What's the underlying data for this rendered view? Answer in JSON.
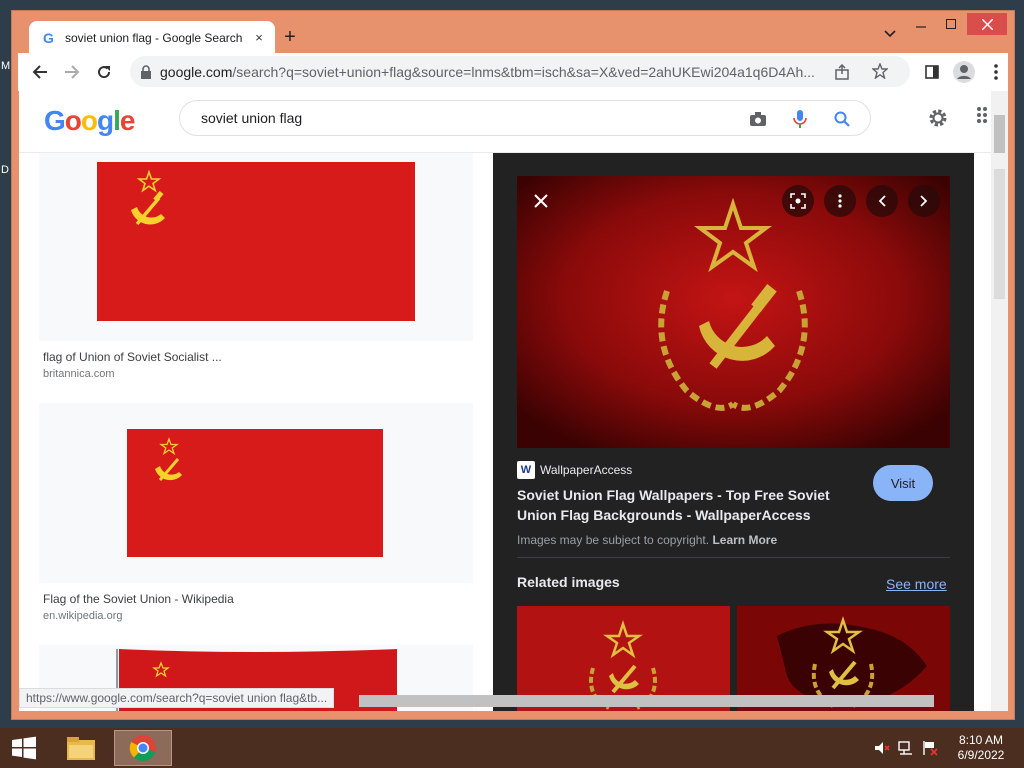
{
  "desktop": {
    "edge_text_1": "M",
    "edge_text_2": "D"
  },
  "tab": {
    "title": "soviet union flag - Google Search",
    "close": "×",
    "new_tab": "+"
  },
  "address_bar": {
    "host": "google.com",
    "path": "/search?q=soviet+union+flag&source=lnms&tbm=isch&sa=X&ved=2ahUKEwi204a1q6D4Ah..."
  },
  "search": {
    "query": "soviet union flag"
  },
  "results": [
    {
      "caption": "flag of Union of Soviet Socialist ...",
      "source": "britannica.com"
    },
    {
      "caption": "Flag of the Soviet Union - Wikipedia",
      "source": "en.wikipedia.org"
    }
  ],
  "preview": {
    "site_name": "WallpaperAccess",
    "site_logo": "W",
    "title": "Soviet Union Flag Wallpapers - Top Free Soviet Union Flag Backgrounds - WallpaperAccess",
    "visit_label": "Visit",
    "copyright_text": "Images may be subject to copyright.",
    "learn_more": "Learn More",
    "related_heading": "Related images",
    "see_more": "See more"
  },
  "status_url": "https://www.google.com/search?q=soviet union flag&tb...",
  "taskbar": {
    "time": "8:10 AM",
    "date": "6/9/2022"
  },
  "colors": {
    "flag_red": "#d71a1a",
    "flag_gold": "#f7d22c",
    "accent_blue": "#8ab4f8",
    "window_frame": "#e8916d"
  }
}
